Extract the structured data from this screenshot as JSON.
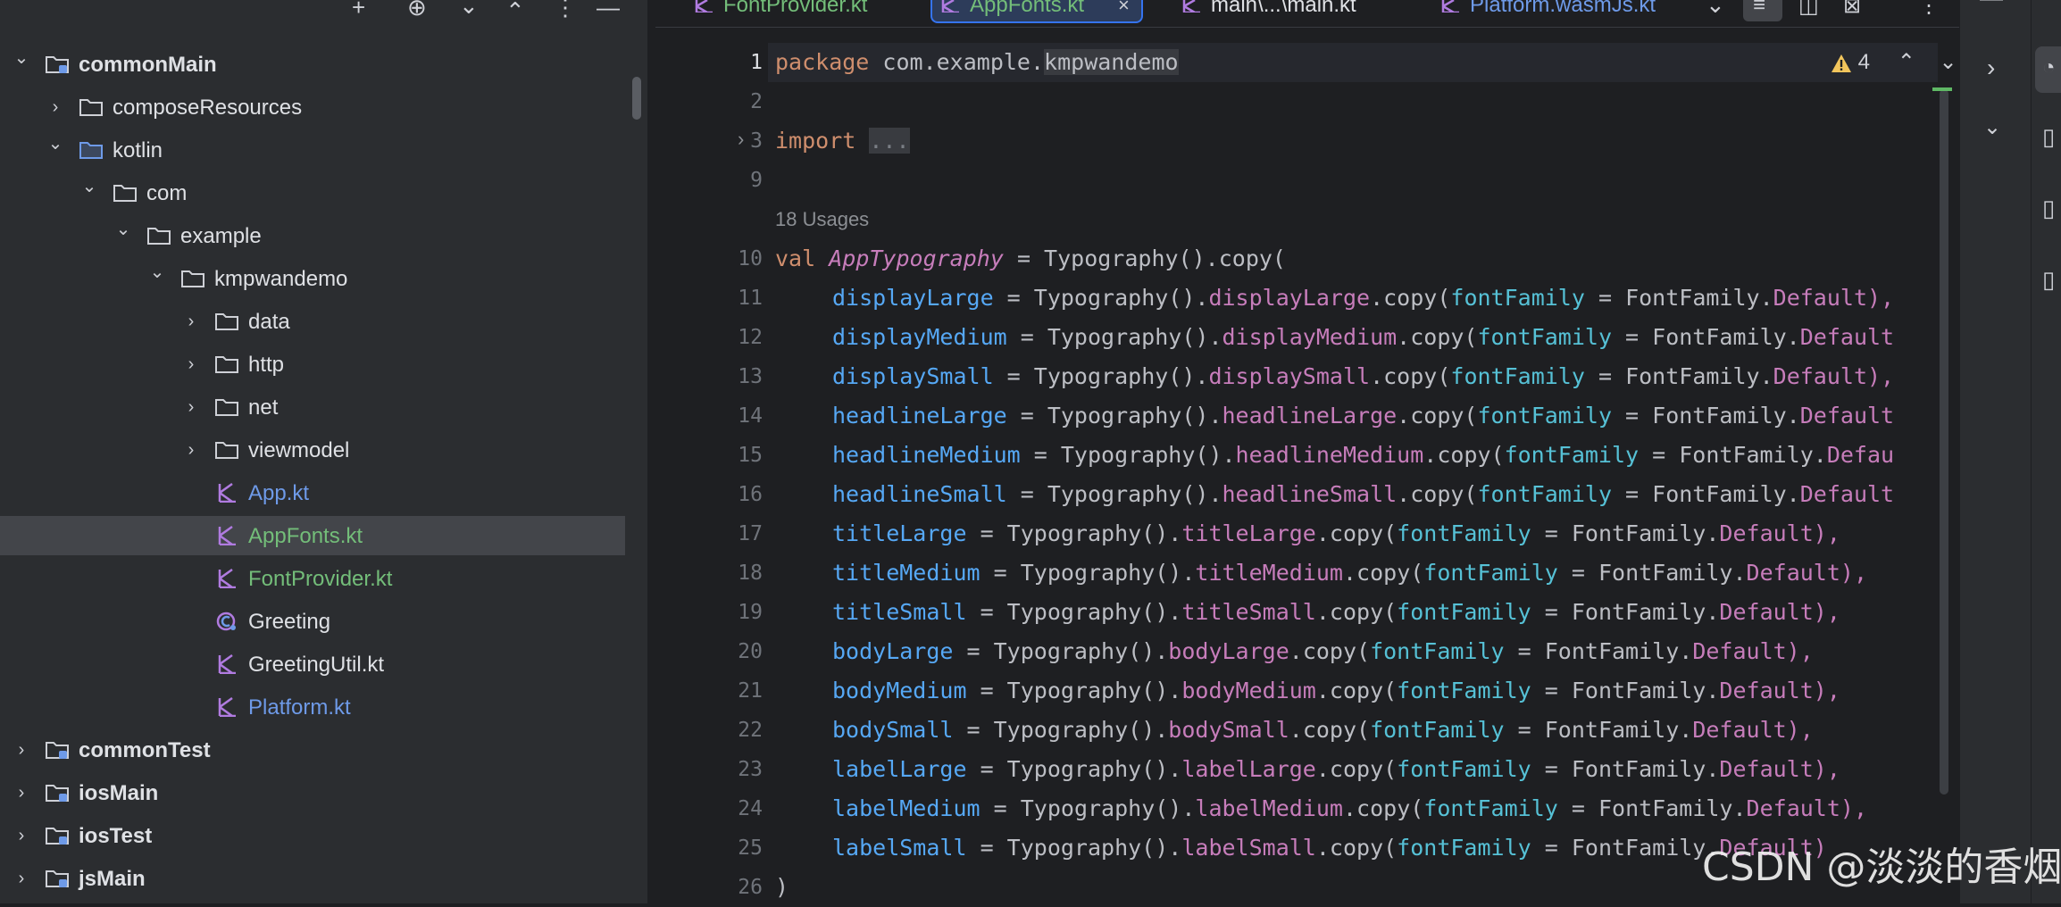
{
  "project_tree": [
    {
      "label": "commonMain",
      "level": 0,
      "expanded": true,
      "type": "module",
      "bold": true
    },
    {
      "label": "composeResources",
      "level": 1,
      "expanded": false,
      "type": "folder"
    },
    {
      "label": "kotlin",
      "level": 1,
      "expanded": true,
      "type": "source-folder"
    },
    {
      "label": "com",
      "level": 2,
      "expanded": true,
      "type": "folder"
    },
    {
      "label": "example",
      "level": 3,
      "expanded": true,
      "type": "folder"
    },
    {
      "label": "kmpwandemo",
      "level": 4,
      "expanded": true,
      "type": "folder"
    },
    {
      "label": "data",
      "level": 5,
      "expanded": false,
      "type": "folder"
    },
    {
      "label": "http",
      "level": 5,
      "expanded": false,
      "type": "folder"
    },
    {
      "label": "net",
      "level": 5,
      "expanded": false,
      "type": "folder"
    },
    {
      "label": "viewmodel",
      "level": 5,
      "expanded": false,
      "type": "folder"
    },
    {
      "label": "App.kt",
      "level": 5,
      "type": "kotlin-file",
      "color": "#6e9ae8"
    },
    {
      "label": "AppFonts.kt",
      "level": 5,
      "type": "kotlin-file",
      "color": "#73bd79",
      "selected": true
    },
    {
      "label": "FontProvider.kt",
      "level": 5,
      "type": "kotlin-file",
      "color": "#73bd79"
    },
    {
      "label": "Greeting",
      "level": 5,
      "type": "kotlin-class",
      "color": "#dfe1e5"
    },
    {
      "label": "GreetingUtil.kt",
      "level": 5,
      "type": "kotlin-file",
      "color": "#dfe1e5"
    },
    {
      "label": "Platform.kt",
      "level": 5,
      "type": "kotlin-file",
      "color": "#6e9ae8"
    },
    {
      "label": "commonTest",
      "level": 0,
      "expanded": false,
      "type": "module",
      "bold": true
    },
    {
      "label": "iosMain",
      "level": 0,
      "expanded": false,
      "type": "module",
      "bold": true
    },
    {
      "label": "iosTest",
      "level": 0,
      "expanded": false,
      "type": "module",
      "bold": true
    },
    {
      "label": "jsMain",
      "level": 0,
      "expanded": false,
      "type": "module",
      "bold": true
    }
  ],
  "tabs": [
    {
      "label": "FontProvider.kt",
      "color": "#73bd79",
      "active": false
    },
    {
      "label": "AppFonts.kt",
      "color": "#73bd79",
      "active": true
    },
    {
      "label": "main\\...\\main.kt",
      "color": "#dfe1e5",
      "active": false
    },
    {
      "label": "Platform.wasmJs.kt",
      "color": "#6e9ae8",
      "active": false
    }
  ],
  "inspection": {
    "warning_count": "4"
  },
  "usages_label": "18 Usages",
  "gutter": [
    "1",
    "2",
    "3",
    "9",
    "10",
    "11",
    "12",
    "13",
    "14",
    "15",
    "16",
    "17",
    "18",
    "19",
    "20",
    "21",
    "22",
    "23",
    "24",
    "25",
    "26"
  ],
  "code": {
    "package_kw": "package",
    "package_prefix": "com.example.",
    "package_name": "kmpwandemo",
    "import_kw": "import",
    "import_fold": "...",
    "val_kw": "val",
    "val_name": "AppTypography",
    "val_rest": " = Typography().copy(",
    "fields": [
      {
        "name": "displayLarge",
        "tail": "Default),"
      },
      {
        "name": "displayMedium",
        "tail": "Default"
      },
      {
        "name": "displaySmall",
        "tail": "Default),"
      },
      {
        "name": "headlineLarge",
        "tail": "Default"
      },
      {
        "name": "headlineMedium",
        "tail": "Defau"
      },
      {
        "name": "headlineSmall",
        "tail": "Default"
      },
      {
        "name": "titleLarge",
        "tail": "Default),"
      },
      {
        "name": "titleMedium",
        "tail": "Default),"
      },
      {
        "name": "titleSmall",
        "tail": "Default),"
      },
      {
        "name": "bodyLarge",
        "tail": "Default),"
      },
      {
        "name": "bodyMedium",
        "tail": "Default),"
      },
      {
        "name": "bodySmall",
        "tail": "Default),"
      },
      {
        "name": "labelLarge",
        "tail": "Default),"
      },
      {
        "name": "labelMedium",
        "tail": "Default),"
      },
      {
        "name": "labelSmall",
        "tail": "Default)"
      }
    ],
    "eq": " = ",
    "typography_call": "Typography().",
    "copy_open": ".copy(",
    "param_name": "fontFamily",
    "font_family_prefix": "FontFamily.",
    "closing": ")"
  },
  "watermark": "CSDN @淡淡的香烟"
}
